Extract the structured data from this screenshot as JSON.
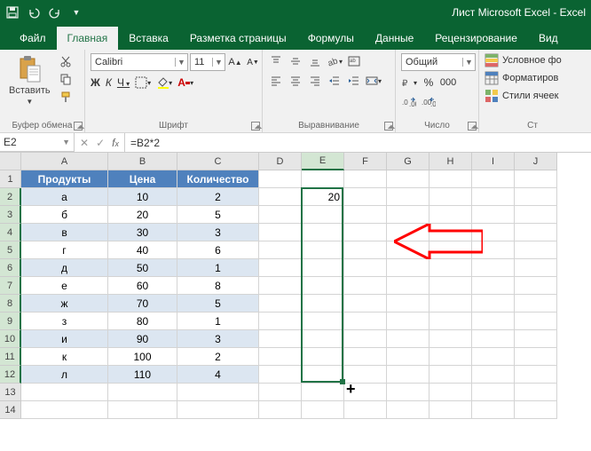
{
  "title": "Лист Microsoft Excel - Excel",
  "tabs": [
    "Файл",
    "Главная",
    "Вставка",
    "Разметка страницы",
    "Формулы",
    "Данные",
    "Рецензирование",
    "Вид"
  ],
  "active_tab": 1,
  "ribbon": {
    "clipboard": {
      "paste": "Вставить",
      "label": "Буфер обмена"
    },
    "font": {
      "name": "Calibri",
      "size": "11",
      "label": "Шрифт",
      "bold": "Ж",
      "italic": "К",
      "underline": "Ч"
    },
    "align": {
      "label": "Выравнивание"
    },
    "number": {
      "format": "Общий",
      "label": "Число"
    },
    "styles": {
      "cond": "Условное фо",
      "fmt": "Форматиров",
      "cell": "Стили ячеек",
      "label": "Ст"
    }
  },
  "namebox": "E2",
  "formula": "=B2*2",
  "cols": [
    {
      "k": "A",
      "w": 98
    },
    {
      "k": "B",
      "w": 78
    },
    {
      "k": "C",
      "w": 92
    },
    {
      "k": "D",
      "w": 48
    },
    {
      "k": "E",
      "w": 48
    },
    {
      "k": "F",
      "w": 48
    },
    {
      "k": "G",
      "w": 48
    },
    {
      "k": "H",
      "w": 48
    },
    {
      "k": "I",
      "w": 48
    },
    {
      "k": "J",
      "w": 48
    }
  ],
  "rows": [
    "1",
    "2",
    "3",
    "4",
    "5",
    "6",
    "7",
    "8",
    "9",
    "10",
    "11",
    "12",
    "13",
    "14"
  ],
  "table": {
    "headers": [
      "Продукты",
      "Цена",
      "Количество"
    ],
    "rows": [
      [
        "а",
        "10",
        "2"
      ],
      [
        "б",
        "20",
        "5"
      ],
      [
        "в",
        "30",
        "3"
      ],
      [
        "г",
        "40",
        "6"
      ],
      [
        "д",
        "50",
        "1"
      ],
      [
        "е",
        "60",
        "8"
      ],
      [
        "ж",
        "70",
        "5"
      ],
      [
        "з",
        "80",
        "1"
      ],
      [
        "и",
        "90",
        "3"
      ],
      [
        "к",
        "100",
        "2"
      ],
      [
        "л",
        "110",
        "4"
      ]
    ]
  },
  "e2_value": "20",
  "selection": {
    "col": 4,
    "row_start": 1,
    "row_end": 11
  },
  "chart_data": {
    "type": "table",
    "title": "Продукты",
    "columns": [
      "Продукты",
      "Цена",
      "Количество"
    ],
    "data": [
      {
        "Продукты": "а",
        "Цена": 10,
        "Количество": 2
      },
      {
        "Продукты": "б",
        "Цена": 20,
        "Количество": 5
      },
      {
        "Продукты": "в",
        "Цена": 30,
        "Количество": 3
      },
      {
        "Продукты": "г",
        "Цена": 40,
        "Количество": 6
      },
      {
        "Продукты": "д",
        "Цена": 50,
        "Количество": 1
      },
      {
        "Продукты": "е",
        "Цена": 60,
        "Количество": 8
      },
      {
        "Продукты": "ж",
        "Цена": 70,
        "Количество": 5
      },
      {
        "Продукты": "з",
        "Цена": 80,
        "Количество": 1
      },
      {
        "Продукты": "и",
        "Цена": 90,
        "Количество": 3
      },
      {
        "Продукты": "к",
        "Цена": 100,
        "Количество": 2
      },
      {
        "Продукты": "л",
        "Цена": 110,
        "Количество": 4
      }
    ],
    "formula_E2": "=B2*2",
    "result_E2": 20
  }
}
